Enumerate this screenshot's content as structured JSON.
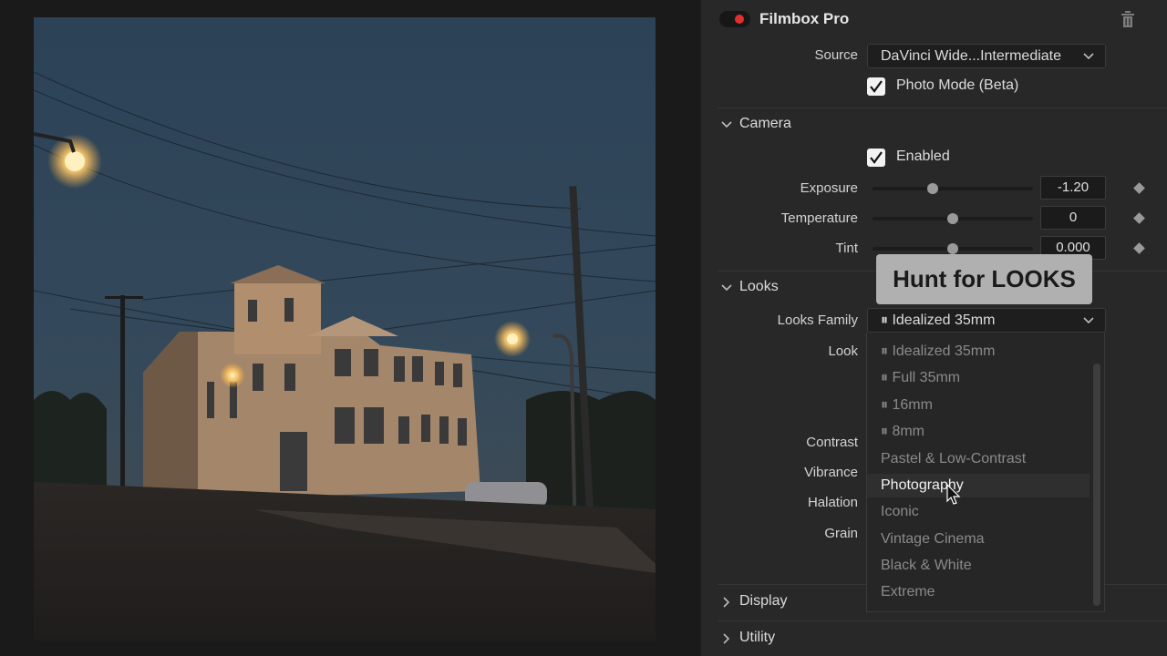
{
  "panel": {
    "title": "Filmbox Pro",
    "source_label": "Source",
    "source_value": "DaVinci Wide...Intermediate",
    "photo_mode_label": "Photo Mode (Beta)",
    "photo_mode_checked": true
  },
  "camera": {
    "section_title": "Camera",
    "enabled_label": "Enabled",
    "enabled_checked": true,
    "params": [
      {
        "label": "Exposure",
        "value": "-1.20"
      },
      {
        "label": "Temperature",
        "value": "0"
      },
      {
        "label": "Tint",
        "value": "0.000"
      }
    ]
  },
  "looks": {
    "section_title": "Looks",
    "family_label": "Looks Family",
    "family_value": "Idealized 35mm",
    "look_label": "Look",
    "other_labels": [
      "Contrast",
      "Vibrance",
      "Halation",
      "Grain"
    ],
    "dropdown_items": [
      "Idealized 35mm",
      "Full 35mm",
      "16mm",
      "8mm",
      "Pastel & Low-Contrast",
      "Photography",
      "Iconic",
      "Vintage Cinema",
      "Black & White",
      "Extreme"
    ],
    "dropdown_selected": "Photography"
  },
  "sections": {
    "display": "Display",
    "utility": "Utility"
  },
  "overlay": {
    "text": "Hunt for LOOKS"
  },
  "colors": {
    "accent_red": "#e52e2e",
    "panel_bg": "#282828",
    "viewer_bg": "#1a1a1a"
  }
}
